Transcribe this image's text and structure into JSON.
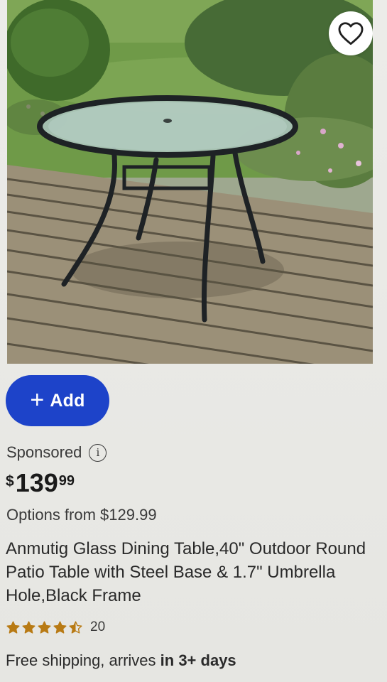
{
  "product": {
    "image_alt": "Round glass patio table with black steel frame on a wooden deck",
    "favorite_icon": "heart-outline-icon",
    "add_button": {
      "icon": "+",
      "label": "Add"
    },
    "sponsored_label": "Sponsored",
    "info_icon": "i",
    "price": {
      "currency": "$",
      "dollars": "139",
      "cents": "99"
    },
    "options_text": "Options from $129.99",
    "title": "Anmutig Glass Dining Table,40\" Outdoor Round Patio Table with Steel Base & 1.7\" Umbrella Hole,Black Frame",
    "rating": {
      "stars": 4.5,
      "max": 5,
      "review_count": "20"
    },
    "shipping": {
      "prefix": "Free shipping, arrives ",
      "emphasis": "in 3+ days"
    }
  },
  "colors": {
    "add_button": "#1d43c9",
    "star": "#b87a14",
    "text": "#2a2a2a"
  }
}
